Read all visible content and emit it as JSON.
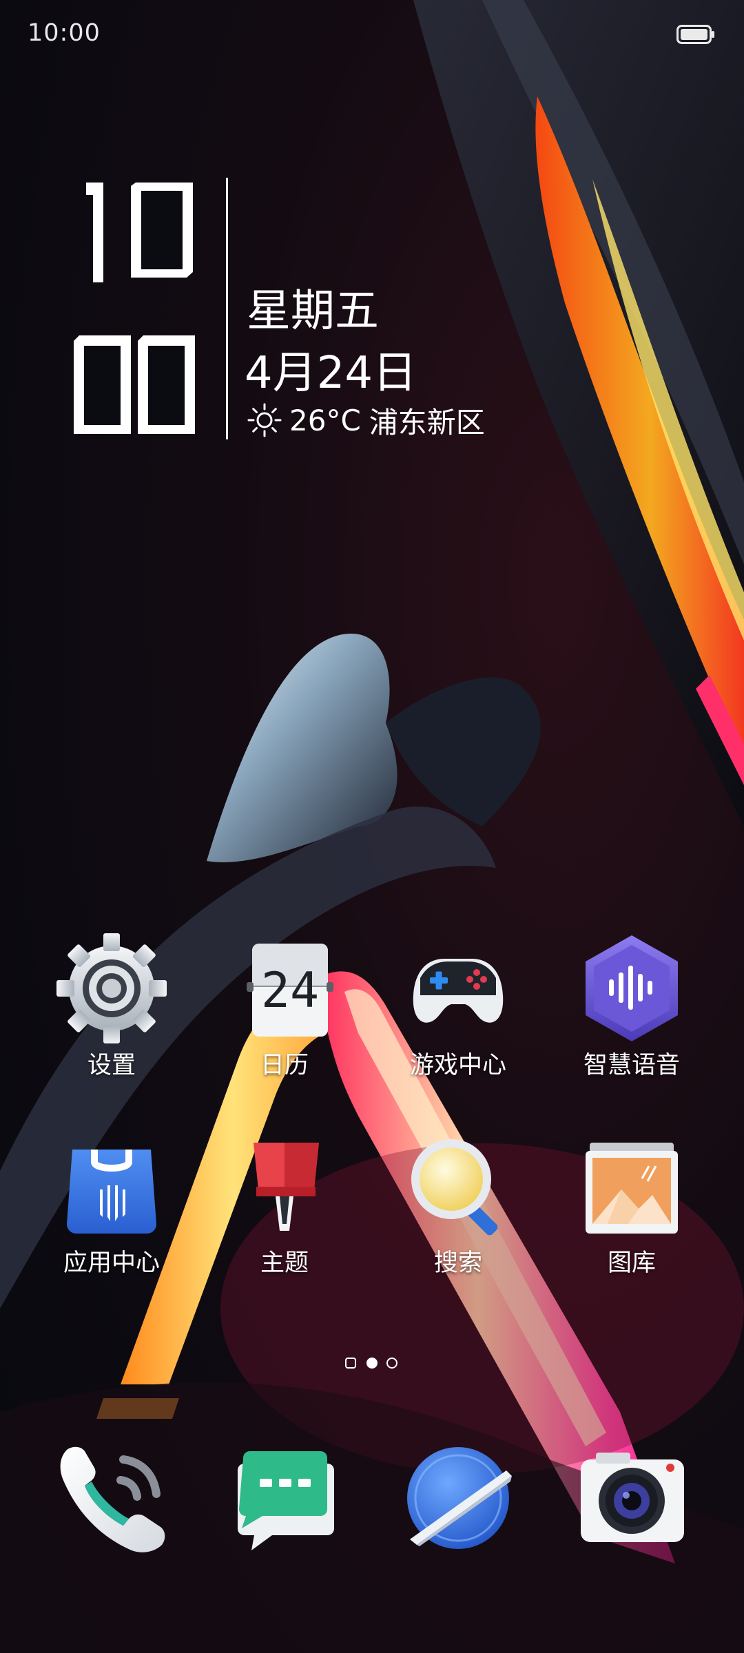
{
  "status_bar": {
    "time": "10:00",
    "icons": [
      "battery-icon"
    ]
  },
  "clock_widget": {
    "hour": "10",
    "minute": "00",
    "weekday": "星期五",
    "date": "4月24日",
    "weather": {
      "icon": "sun-icon",
      "temperature": "26°C",
      "location": "浦东新区"
    }
  },
  "apps": [
    {
      "label": "设置",
      "icon": "settings-gear-icon"
    },
    {
      "label": "日历",
      "icon": "calendar-icon",
      "icon_text": "24"
    },
    {
      "label": "游戏中心",
      "icon": "gamepad-icon"
    },
    {
      "label": "智慧语音",
      "icon": "voice-assistant-icon"
    },
    {
      "label": "应用中心",
      "icon": "app-store-icon"
    },
    {
      "label": "主题",
      "icon": "theme-brush-icon"
    },
    {
      "label": "搜索",
      "icon": "search-magnifier-icon"
    },
    {
      "label": "图库",
      "icon": "gallery-icon"
    }
  ],
  "page_indicator": {
    "count": 3,
    "active_index": 1
  },
  "dock": [
    {
      "icon": "phone-icon"
    },
    {
      "icon": "messages-icon"
    },
    {
      "icon": "browser-icon"
    },
    {
      "icon": "camera-icon"
    }
  ],
  "colors": {
    "accent_orange": "#ff6a1a",
    "accent_pink": "#ff2f7d",
    "accent_yellow": "#ffe070",
    "background": "#0b0c12"
  }
}
